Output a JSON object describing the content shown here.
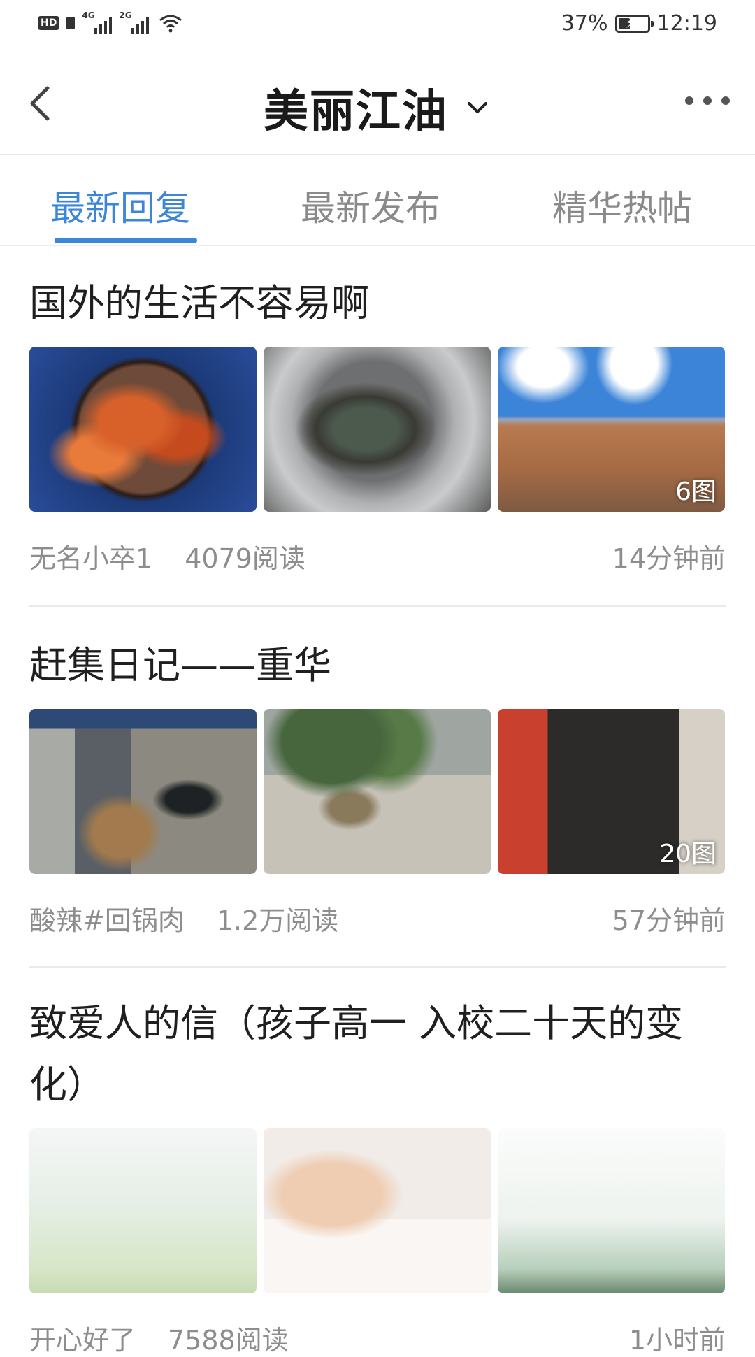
{
  "status_bar": {
    "hd": "HD",
    "net1": "4G",
    "net2": "2G",
    "battery_text": "37%",
    "battery_level": 0.37,
    "time": "12:19"
  },
  "header": {
    "title": "美丽江油",
    "icons": {
      "back": "back-arrow-icon",
      "dropdown": "chevron-down-icon",
      "more": "more-dots-icon"
    }
  },
  "tabs": [
    {
      "label": "最新回复",
      "active": true
    },
    {
      "label": "最新发布",
      "active": false
    },
    {
      "label": "精华热帖",
      "active": false
    }
  ],
  "posts": [
    {
      "title": "国外的生活不容易啊",
      "image_count_label": "6图",
      "author": "无名小卒1",
      "reads": "4079阅读",
      "time": "14分钟前"
    },
    {
      "title": "赶集日记——重华",
      "image_count_label": "20图",
      "author": "酸辣#回锅肉",
      "reads": "1.2万阅读",
      "time": "57分钟前"
    },
    {
      "title": "致爱人的信（孩子高一 入校二十天的变化）",
      "author": "开心好了",
      "reads": "7588阅读",
      "time": "1小时前"
    }
  ],
  "colors": {
    "accent": "#3b86d6",
    "meta_text": "#8d8d8d"
  }
}
